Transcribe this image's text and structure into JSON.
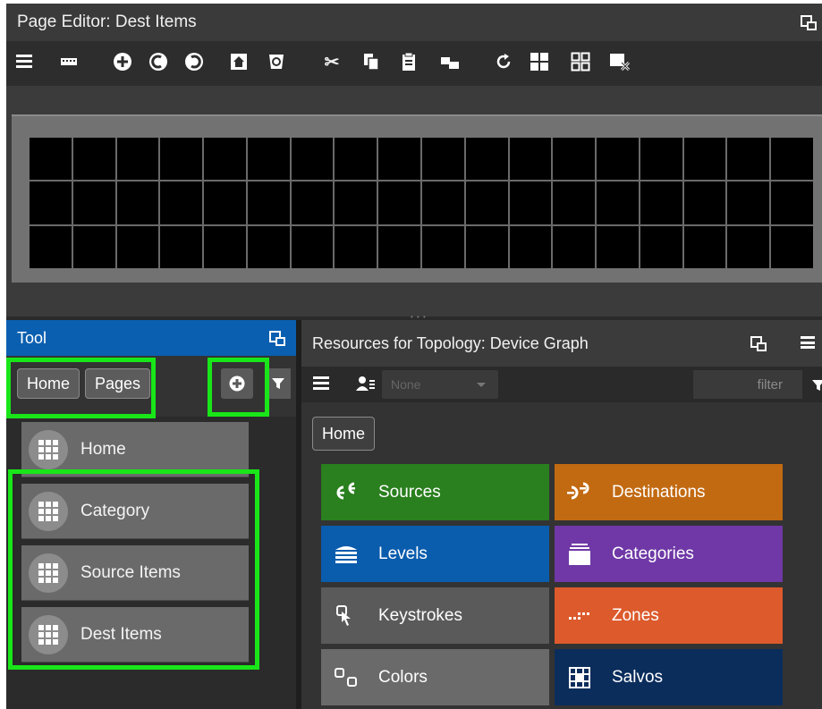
{
  "editor": {
    "title": "Page Editor: Dest Items",
    "toolbar_icons": [
      "list-icon",
      "keyboard-icon",
      "add-circle-icon",
      "arrow-left-circle-icon",
      "arrow-right-circle-icon",
      "home-icon",
      "trash-icon",
      "cut-icon",
      "copy-icon",
      "paste-icon",
      "duplicate-icon",
      "refresh-icon",
      "grid-large-icon",
      "grid-small-icon",
      "clear-grid-icon"
    ],
    "grid": {
      "rows": 3,
      "columns": 18
    }
  },
  "tool_panel": {
    "title": "Tool",
    "breadcrumbs": [
      "Home",
      "Pages"
    ],
    "pages": [
      "Home",
      "Category",
      "Source Items",
      "Dest Items"
    ]
  },
  "resources": {
    "title": "Resources for Topology: Device Graph",
    "selector_value": "None",
    "filter_placeholder": "filter",
    "breadcrumb": "Home",
    "tiles": [
      {
        "label": "Sources",
        "color": "#2a7f1e",
        "icon": "sources-icon"
      },
      {
        "label": "Destinations",
        "color": "#c26a12",
        "icon": "destinations-icon"
      },
      {
        "label": "Levels",
        "color": "#0a5cad",
        "icon": "levels-icon"
      },
      {
        "label": "Categories",
        "color": "#6f38a6",
        "icon": "categories-icon"
      },
      {
        "label": "Keystrokes",
        "color": "#5a5a5a",
        "icon": "keystrokes-icon"
      },
      {
        "label": "Zones",
        "color": "#dc5a2c",
        "icon": "zones-icon"
      },
      {
        "label": "Colors",
        "color": "#6a6a6a",
        "icon": "colors-icon"
      },
      {
        "label": "Salvos",
        "color": "#0b2d5c",
        "icon": "salvos-icon"
      }
    ]
  },
  "highlight_color": "#19e619"
}
